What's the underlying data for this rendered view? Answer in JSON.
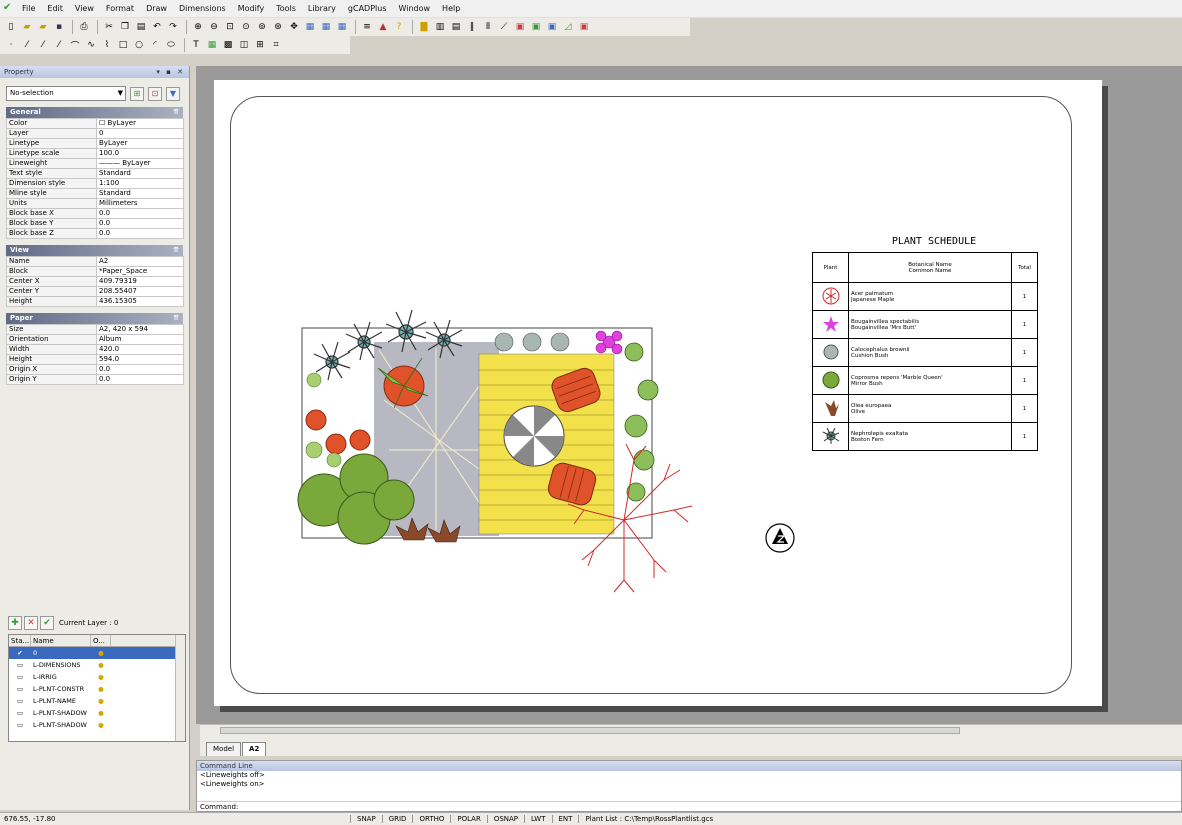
{
  "menu": {
    "items": [
      "File",
      "Edit",
      "View",
      "Format",
      "Draw",
      "Dimensions",
      "Modify",
      "Tools",
      "Library",
      "gCADPlus",
      "Window",
      "Help"
    ]
  },
  "panel": {
    "title": "Property",
    "title_controls": "▾ ▪ ✕",
    "selection": "No-selection",
    "sections": [
      {
        "name": "General",
        "rows": [
          {
            "k": "Color",
            "v": "☐ ByLayer"
          },
          {
            "k": "Layer",
            "v": "0"
          },
          {
            "k": "Linetype",
            "v": "ByLayer"
          },
          {
            "k": "Linetype scale",
            "v": "100.0"
          },
          {
            "k": "Lineweight",
            "v": "——— ByLayer"
          },
          {
            "k": "Text style",
            "v": "Standard"
          },
          {
            "k": "Dimension style",
            "v": "1:100"
          },
          {
            "k": "Mline style",
            "v": "Standard"
          },
          {
            "k": "Units",
            "v": "Millimeters"
          },
          {
            "k": "Block base X",
            "v": "0.0"
          },
          {
            "k": "Block base Y",
            "v": "0.0"
          },
          {
            "k": "Block base Z",
            "v": "0.0"
          }
        ]
      },
      {
        "name": "View",
        "rows": [
          {
            "k": "Name",
            "v": "A2"
          },
          {
            "k": "Block",
            "v": "*Paper_Space"
          },
          {
            "k": "Center X",
            "v": "409.79319"
          },
          {
            "k": "Center Y",
            "v": "208.55407"
          },
          {
            "k": "Height",
            "v": "436.15305"
          }
        ]
      },
      {
        "name": "Paper",
        "rows": [
          {
            "k": "Size",
            "v": "A2, 420 x 594"
          },
          {
            "k": "Orientation",
            "v": "Album"
          },
          {
            "k": "Width",
            "v": "420.0"
          },
          {
            "k": "Height",
            "v": "594.0"
          },
          {
            "k": "Origin X",
            "v": "0.0"
          },
          {
            "k": "Origin Y",
            "v": "0.0"
          }
        ]
      }
    ]
  },
  "layers": {
    "current_label": "Current Layer : 0",
    "columns": [
      "Sta...",
      "Name",
      "O..."
    ],
    "rows": [
      {
        "name": "0",
        "selected": true
      },
      {
        "name": "L-DIMENSIONS",
        "selected": false
      },
      {
        "name": "L-IRRIG",
        "selected": false
      },
      {
        "name": "L-PLNT-CONSTR",
        "selected": false
      },
      {
        "name": "L-PLNT-NAME",
        "selected": false
      },
      {
        "name": "L-PLNT-SHADOW",
        "selected": false
      },
      {
        "name": "L-PLNT-SHADOW",
        "selected": false
      }
    ]
  },
  "schedule": {
    "title": "PLANT SCHEDULE",
    "headers": {
      "plant": "Plant",
      "name": "Botanical Name\nCommon Name",
      "total": "Total"
    },
    "rows": [
      {
        "name": "Acer palmatum\nJapanese Maple",
        "total": "1",
        "icon": "red-circle"
      },
      {
        "name": "Bougainvillea spectabilis\nBougainvillea 'Mrs Butt'",
        "total": "1",
        "icon": "magenta-star"
      },
      {
        "name": "Calocephalus brownii\nCushion Bush",
        "total": "1",
        "icon": "gray-puff"
      },
      {
        "name": "Coprosma repens 'Marble Queen'\nMirror Bush",
        "total": "1",
        "icon": "green-ball"
      },
      {
        "name": "Olea europaea\nOlive",
        "total": "1",
        "icon": "brown-leaves"
      },
      {
        "name": "Nephrolepis exaltata\nBoston Fern",
        "total": "1",
        "icon": "dark-spiky"
      }
    ]
  },
  "tabs": [
    "Model",
    "A2"
  ],
  "active_tab": "A2",
  "command": {
    "title": "Command Line",
    "history": [
      "<Lineweights off>",
      "<Lineweights on>"
    ],
    "prompt": "Command:"
  },
  "status": {
    "coords": "676.55, -17.80",
    "buttons": [
      "SNAP",
      "GRID",
      "ORTHO",
      "POLAR",
      "OSNAP",
      "LWT",
      "ENT"
    ],
    "path": "Plant List : C:\\Temp\\RossPlantlist.gcs"
  }
}
